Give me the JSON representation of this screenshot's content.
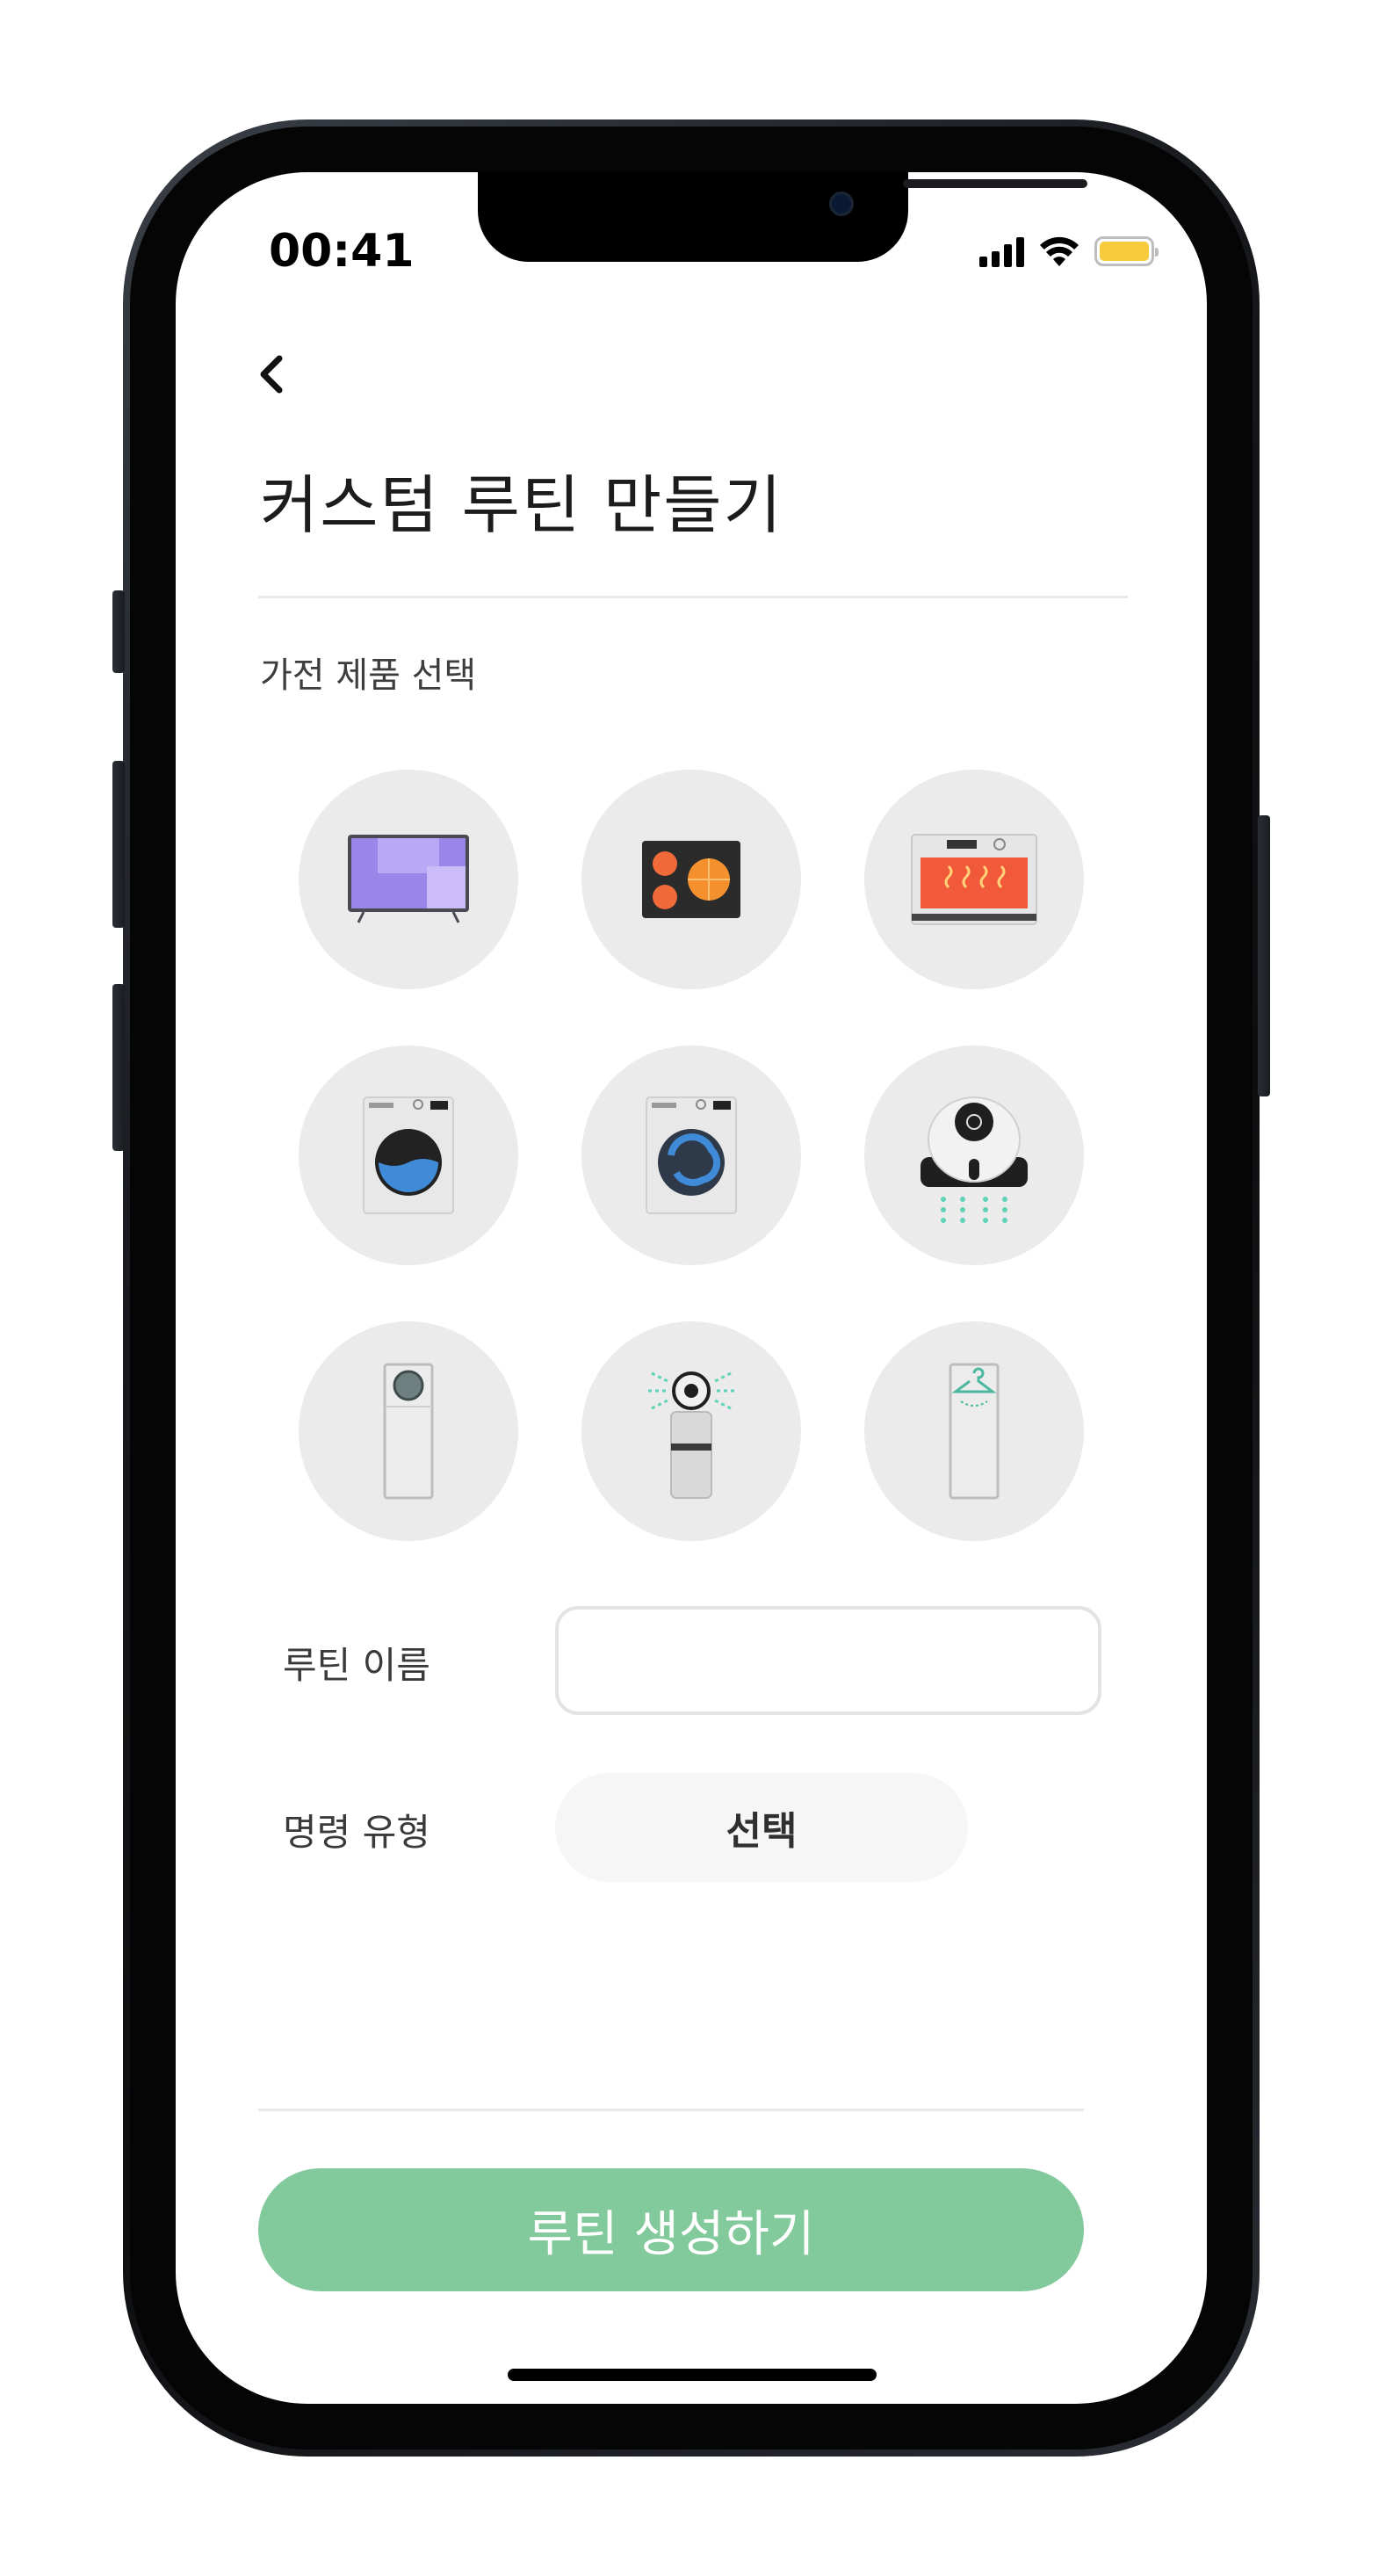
{
  "status_bar": {
    "time": "00:41"
  },
  "header": {
    "back_label": "‹",
    "title": "커스텀 루틴 만들기"
  },
  "appliance_section": {
    "label": "가전 제품 선택",
    "devices": [
      {
        "icon": "tv-icon"
      },
      {
        "icon": "cooktop-icon"
      },
      {
        "icon": "oven-icon"
      },
      {
        "icon": "washer-icon"
      },
      {
        "icon": "dryer-icon"
      },
      {
        "icon": "robot-purifier-icon"
      },
      {
        "icon": "air-conditioner-icon"
      },
      {
        "icon": "air-purifier-icon"
      },
      {
        "icon": "clothing-care-icon"
      }
    ]
  },
  "form": {
    "routine_name_label": "루틴 이름",
    "routine_name_value": "",
    "command_type_label": "명령 유형",
    "command_type_value": "선택"
  },
  "footer": {
    "create_button_label": "루틴 생성하기"
  },
  "colors": {
    "accent_green": "#82c99c",
    "device_circle": "#ebebeb",
    "battery": "#f7cb3c"
  }
}
